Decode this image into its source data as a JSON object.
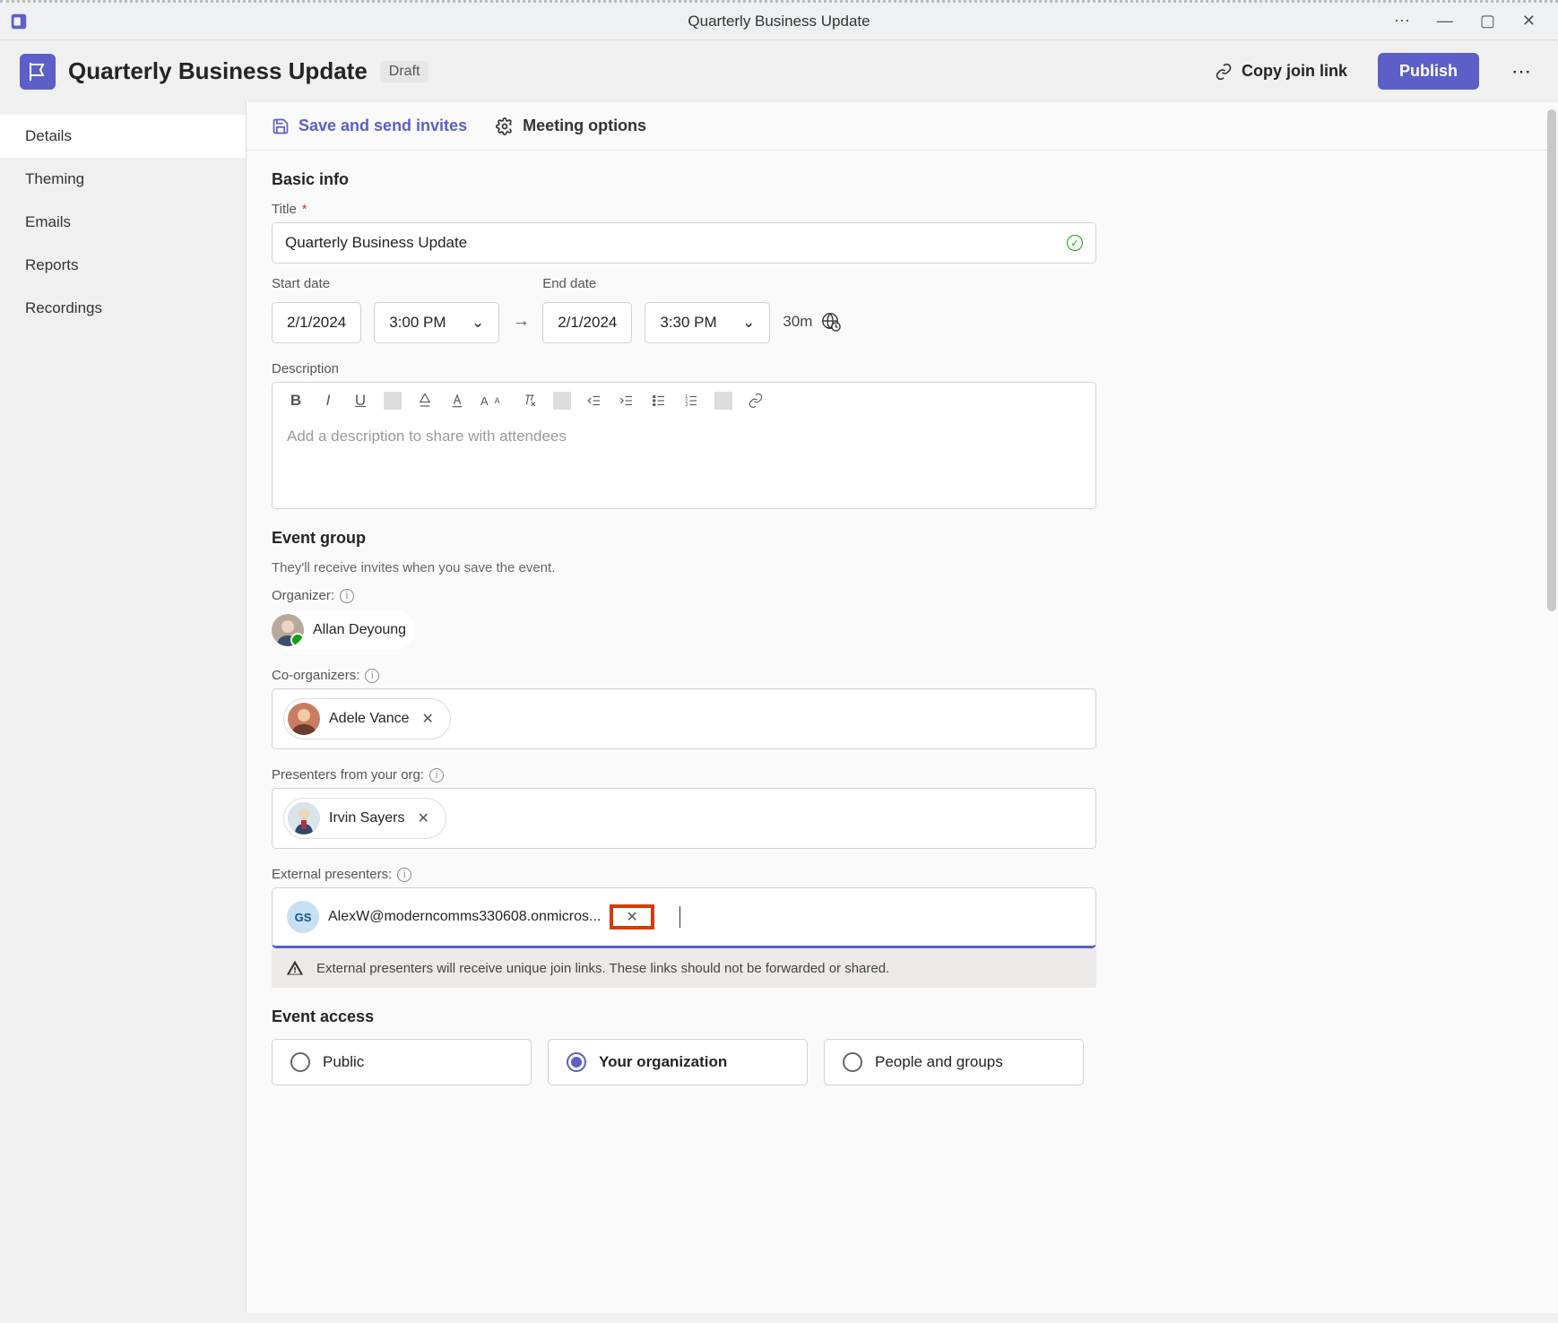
{
  "window": {
    "title": "Quarterly Business Update"
  },
  "header": {
    "title": "Quarterly Business Update",
    "badge": "Draft",
    "copy_link": "Copy join link",
    "publish": "Publish"
  },
  "sidebar": {
    "items": [
      {
        "label": "Details",
        "active": true
      },
      {
        "label": "Theming",
        "active": false
      },
      {
        "label": "Emails",
        "active": false
      },
      {
        "label": "Reports",
        "active": false
      },
      {
        "label": "Recordings",
        "active": false
      }
    ]
  },
  "action_bar": {
    "save": "Save and send invites",
    "options": "Meeting options"
  },
  "basic_info": {
    "section_title": "Basic info",
    "title_label": "Title",
    "title_value": "Quarterly Business Update",
    "start_date_label": "Start date",
    "start_date": "2/1/2024",
    "start_time": "3:00 PM",
    "end_date_label": "End date",
    "end_date": "2/1/2024",
    "end_time": "3:30 PM",
    "duration": "30m",
    "description_label": "Description",
    "description_placeholder": "Add a description to share with attendees"
  },
  "event_group": {
    "section_title": "Event group",
    "subtext": "They'll receive invites when you save the event.",
    "organizer_label": "Organizer:",
    "organizer": {
      "name": "Allan Deyoung"
    },
    "coorganizers_label": "Co-organizers:",
    "coorganizers": [
      {
        "name": "Adele Vance"
      }
    ],
    "presenters_label": "Presenters from your org:",
    "presenters": [
      {
        "name": "Irvin Sayers"
      }
    ],
    "external_label": "External presenters:",
    "external": [
      {
        "initials": "GS",
        "email": "AlexW@moderncomms330608.onmicros..."
      }
    ],
    "external_warning": "External presenters will receive unique join links. These links should not be forwarded or shared."
  },
  "event_access": {
    "section_title": "Event access",
    "options": [
      {
        "label": "Public",
        "selected": false
      },
      {
        "label": "Your organization",
        "selected": true
      },
      {
        "label": "People and groups",
        "selected": false
      }
    ]
  }
}
